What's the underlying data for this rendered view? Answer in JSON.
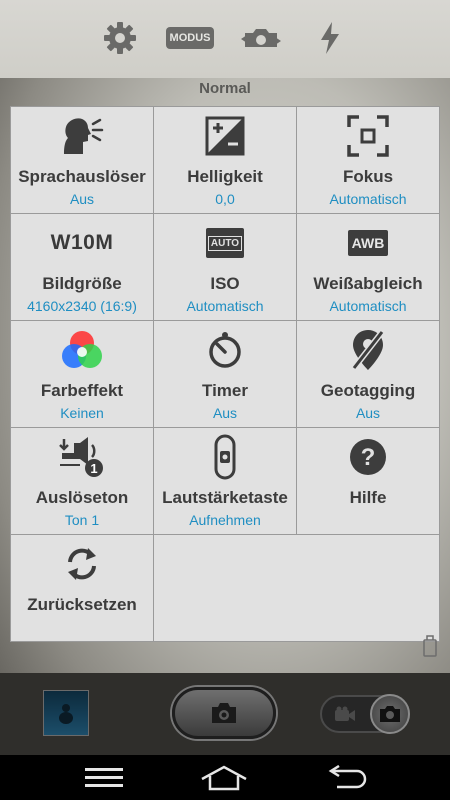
{
  "top_toolbar": {
    "icons": [
      "gear-icon",
      "mode-icon",
      "camera-switch-icon",
      "flash-icon"
    ],
    "mode_button_label": "MODUS",
    "mode_value": "Normal"
  },
  "settings": [
    {
      "title": "Sprachauslöser",
      "value": "Aus",
      "icon": "voice-shutter-icon"
    },
    {
      "title": "Helligkeit",
      "value": "0,0",
      "icon": "brightness-icon"
    },
    {
      "title": "Fokus",
      "value": "Automatisch",
      "icon": "focus-icon"
    },
    {
      "title": "Bildgröße",
      "value": "4160x2340 (16:9)",
      "icon": "image-size-icon",
      "icon_text": "W10M"
    },
    {
      "title": "ISO",
      "value": "Automatisch",
      "icon": "iso-icon",
      "icon_text": "AUTO"
    },
    {
      "title": "Weißabgleich",
      "value": "Automatisch",
      "icon": "white-balance-icon",
      "icon_text": "AWB"
    },
    {
      "title": "Farbeffekt",
      "value": "Keinen",
      "icon": "color-effect-icon"
    },
    {
      "title": "Timer",
      "value": "Aus",
      "icon": "timer-icon"
    },
    {
      "title": "Geotagging",
      "value": "Aus",
      "icon": "geotagging-icon"
    },
    {
      "title": "Auslöseton",
      "value": "Ton 1",
      "icon": "shutter-sound-icon",
      "icon_text": "1"
    },
    {
      "title": "Lautstärketaste",
      "value": "Aufnehmen",
      "icon": "volume-key-icon"
    },
    {
      "title": "Hilfe",
      "value": "",
      "icon": "help-icon"
    },
    {
      "title": "Zurücksetzen",
      "value": "",
      "icon": "reset-icon"
    }
  ],
  "bottom_controls": {
    "gallery_thumbnail": "gallery-thumbnail",
    "shutter": "camera-icon",
    "mode_switch": [
      "video-icon",
      "camera-icon"
    ]
  },
  "navigation": [
    "menu-icon",
    "home-icon",
    "back-icon"
  ],
  "colors": {
    "accent_blue": "#1f8ec2",
    "panel_bg": "#e1e1e1",
    "icon_dark": "#3d3d3d"
  }
}
